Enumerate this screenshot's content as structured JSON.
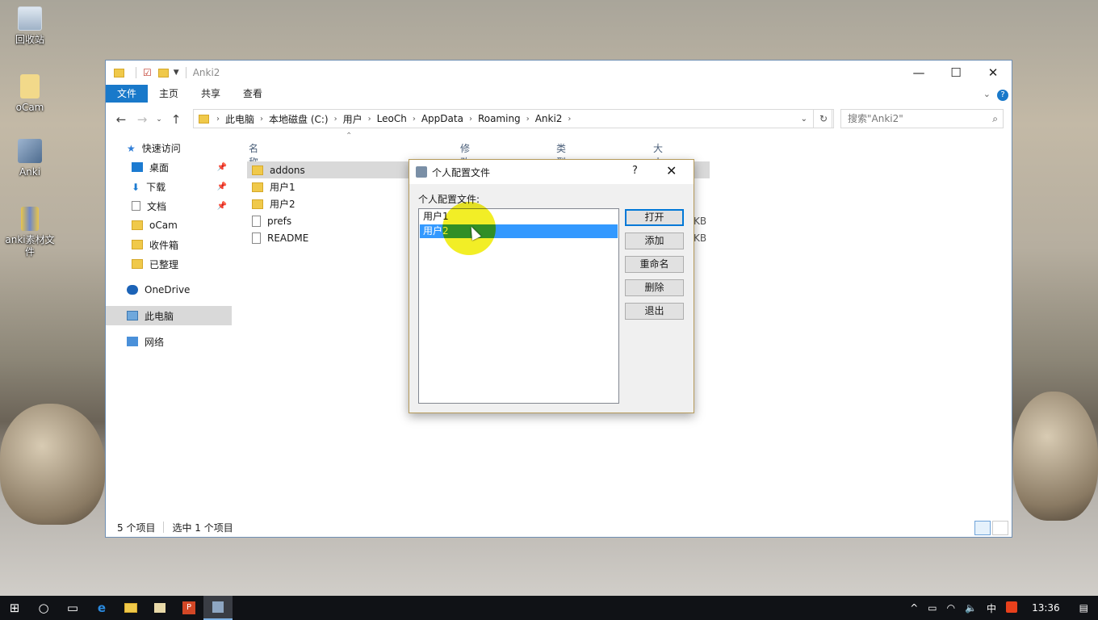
{
  "desktop": {
    "icons": [
      {
        "label": "回收站",
        "icon": "recycle-bin-icon"
      },
      {
        "label": "oCam",
        "icon": "ocam-icon"
      },
      {
        "label": "Anki",
        "icon": "anki-icon"
      },
      {
        "label": "anki素材文件",
        "icon": "zip-archive-icon"
      }
    ]
  },
  "explorer": {
    "title": "Anki2",
    "controls": {
      "minimize": "—",
      "maximize": "☐",
      "close": "✕"
    },
    "ribbon": {
      "tabs": [
        "文件",
        "主页",
        "共享",
        "查看"
      ],
      "help": "?"
    },
    "address": {
      "crumbs": [
        "此电脑",
        "本地磁盘 (C:)",
        "用户",
        "LeoCh",
        "AppData",
        "Roaming",
        "Anki2"
      ],
      "search_placeholder": "搜索\"Anki2\""
    },
    "nav": {
      "items": [
        {
          "label": "快速访问",
          "pinned": false,
          "icon": "star-icon"
        },
        {
          "label": "桌面",
          "pinned": true,
          "icon": "desktop-icon"
        },
        {
          "label": "下载",
          "pinned": true,
          "icon": "download-icon"
        },
        {
          "label": "文档",
          "pinned": true,
          "icon": "document-icon"
        },
        {
          "label": "oCam",
          "pinned": false,
          "icon": "folder-icon"
        },
        {
          "label": "收件箱",
          "pinned": false,
          "icon": "folder-icon"
        },
        {
          "label": "已整理",
          "pinned": false,
          "icon": "folder-icon"
        },
        {
          "label": "OneDrive",
          "pinned": false,
          "icon": "onedrive-icon"
        },
        {
          "label": "此电脑",
          "pinned": false,
          "icon": "computer-icon",
          "selected": true
        },
        {
          "label": "网络",
          "pinned": false,
          "icon": "network-icon"
        }
      ]
    },
    "columns": {
      "name": "名称",
      "modified": "修改日期",
      "type": "类型",
      "size": "大小"
    },
    "files": [
      {
        "name": "addons",
        "kind": "folder",
        "selected": true,
        "size": ""
      },
      {
        "name": "用户1",
        "kind": "folder",
        "size": ""
      },
      {
        "name": "用户2",
        "kind": "folder",
        "size": ""
      },
      {
        "name": "prefs",
        "kind": "file",
        "size": "KB"
      },
      {
        "name": "README",
        "kind": "file",
        "size": "KB"
      }
    ],
    "status": {
      "count": "5 个项目",
      "selected": "选中 1 个项目"
    }
  },
  "dialog": {
    "title": "个人配置文件",
    "help": "?",
    "close": "✕",
    "label": "个人配置文件:",
    "profiles": [
      "用户1",
      "用户2"
    ],
    "selected_index": 1,
    "buttons": {
      "open": "打开",
      "add": "添加",
      "rename": "重命名",
      "delete": "删除",
      "quit": "退出"
    }
  },
  "taskbar": {
    "clock": "13:36",
    "ime": "中",
    "apps": [
      "start-icon",
      "cortana-icon",
      "task-view-icon",
      "edge-icon",
      "file-explorer-icon",
      "ocam-icon",
      "powerpoint-icon",
      "anki-icon"
    ]
  }
}
